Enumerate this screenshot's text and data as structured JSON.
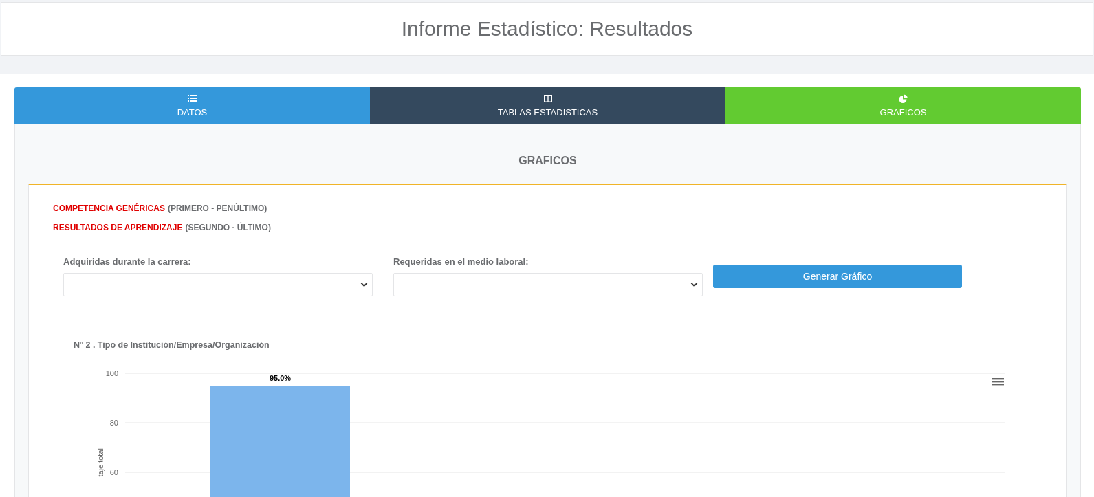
{
  "header": {
    "title": "Informe Estadístico: Resultados"
  },
  "tabs": [
    {
      "label": "DATOS",
      "color": "#3498db"
    },
    {
      "label": "TABLAS ESTADISTICAS",
      "color": "#34495e"
    },
    {
      "label": "GRAFICOS",
      "color": "#62cb31"
    }
  ],
  "panel": {
    "heading": "GRAFICOS",
    "legend": [
      {
        "highlight": "COMPETENCIA GENÉRICAS",
        "note": "(PRIMERO - PENÚLTIMO)"
      },
      {
        "highlight": "RESULTADOS DE APRENDIZAJE",
        "note": "(SEGUNDO - ÚLTIMO)"
      }
    ],
    "filters": [
      {
        "label": "Adquiridas durante la carrera:"
      },
      {
        "label": "Requeridas en el medio laboral:"
      }
    ],
    "button": "Generar Gráfico",
    "chart": {
      "title": "N° 2 . Tipo de Institución/Empresa/Organización",
      "chart_data": {
        "type": "bar",
        "ylabel": "taje total",
        "values": [
          95
        ],
        "ylim": [
          0,
          100
        ],
        "yticks": [
          60,
          80,
          100
        ],
        "value_labels": [
          "95.0%"
        ]
      }
    }
  }
}
